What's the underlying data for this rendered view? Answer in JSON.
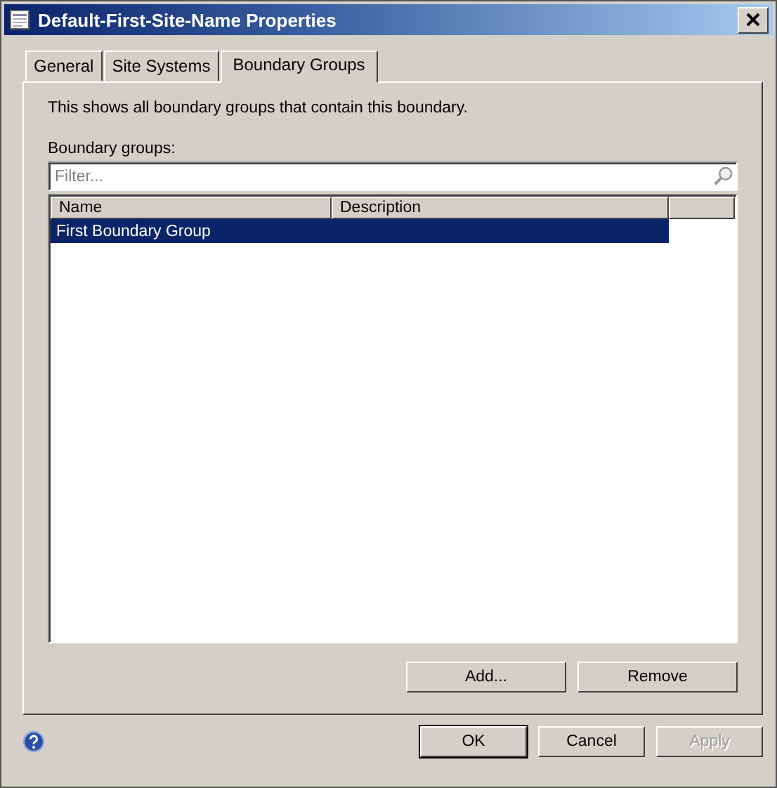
{
  "window": {
    "title": "Default-First-Site-Name Properties"
  },
  "tabs": [
    {
      "label": "General",
      "selected": false
    },
    {
      "label": "Site Systems",
      "selected": false
    },
    {
      "label": "Boundary Groups",
      "selected": true
    }
  ],
  "description": "This shows all boundary groups that contain this boundary.",
  "list_label": "Boundary groups:",
  "filter": {
    "placeholder": "Filter..."
  },
  "table": {
    "columns": [
      "Name",
      "Description"
    ],
    "rows": [
      {
        "cells": [
          "First Boundary Group",
          ""
        ],
        "selected": true
      }
    ]
  },
  "list_buttons": [
    {
      "label": "Add...",
      "disabled": false
    },
    {
      "label": "Remove",
      "disabled": false
    }
  ],
  "dialog_buttons": [
    {
      "label": "OK",
      "disabled": false,
      "default": true
    },
    {
      "label": "Cancel",
      "disabled": false,
      "default": false
    },
    {
      "label": "Apply",
      "disabled": true,
      "default": false
    }
  ]
}
